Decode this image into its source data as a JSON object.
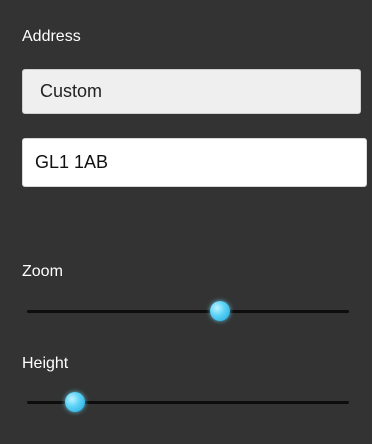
{
  "address": {
    "label": "Address",
    "mode_value": "Custom",
    "postcode_value": "GL1 1AB"
  },
  "zoom": {
    "label": "Zoom",
    "value_fraction": 0.6
  },
  "height": {
    "label": "Height",
    "value_fraction": 0.15
  },
  "colors": {
    "panel_background": "#333333",
    "label_text": "#ffffff",
    "slider_track": "#0d0d0d",
    "slider_thumb": "#4cc8f0"
  }
}
